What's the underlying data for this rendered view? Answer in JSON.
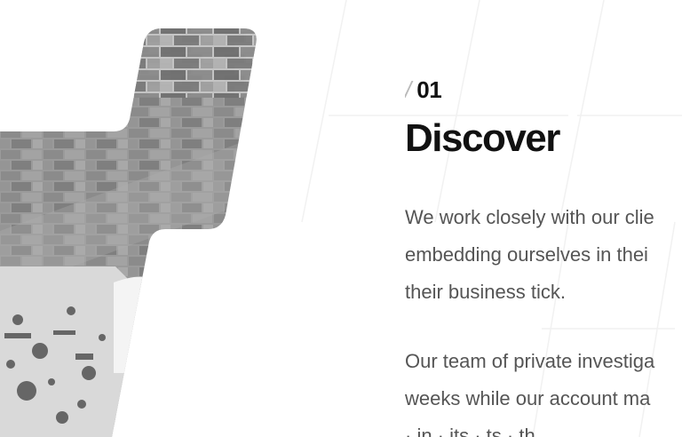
{
  "section": {
    "step_slash": "/",
    "step_number": "01",
    "title": "Discover",
    "paragraphs": [
      {
        "lines": [
          "We work closely with our clie",
          "embedding ourselves in thei",
          "their business tick."
        ]
      },
      {
        "lines": [
          "Our team of private investiga",
          "weeks while our account ma",
          "  ·  in  ·  its  ·  ts  ·  th"
        ]
      }
    ]
  },
  "colors": {
    "title": "#111111",
    "body": "#555555",
    "slash": "#b9b9b9",
    "background": "#ffffff"
  }
}
